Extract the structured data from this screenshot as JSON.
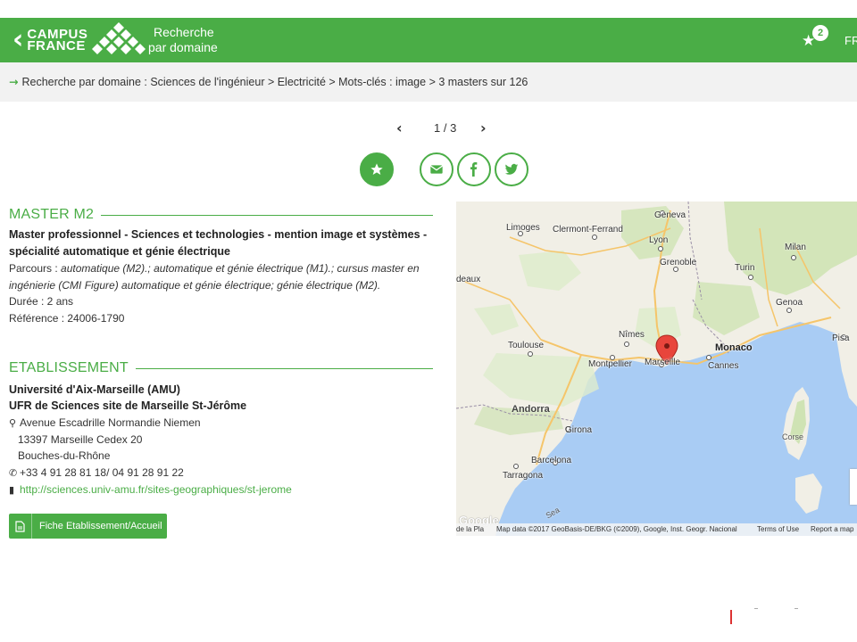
{
  "header": {
    "brand_line1": "CAMPUS",
    "brand_line2": "FRANCE",
    "section_line1": "Recherche",
    "section_line2": "par domaine",
    "favorites_count": "2",
    "language": "FR",
    "color": "#4aad46"
  },
  "breadcrumb": {
    "text": "Recherche par domaine : Sciences de l'ingénieur > Electricité > Mots-clés : image > 3 masters sur 126"
  },
  "pager": {
    "current": "1 / 3"
  },
  "actions": {
    "icons": [
      "star-icon",
      "mail-icon",
      "facebook-icon",
      "twitter-icon"
    ]
  },
  "master": {
    "heading": "MASTER M2",
    "title": "Master professionnel - Sciences et technologies - mention image et systèmes - spécialité automatique et génie électrique",
    "parcours_label": "Parcours : ",
    "parcours_value": "automatique (M2).; automatique et génie électrique (M1).; cursus master en ingénierie (CMI Figure) automatique et génie électrique; génie électrique (M2).",
    "duration": "Durée : 2 ans",
    "reference": "Référence : 24006-1790"
  },
  "etablissement": {
    "heading": "ETABLISSEMENT",
    "university": "Université d'Aix-Marseille (AMU)",
    "ufr": "UFR de Sciences site de Marseille St-Jérôme",
    "address": "Avenue Escadrille Normandie Niemen",
    "postal": "13397 Marseille Cedex 20",
    "department": "Bouches-du-Rhône",
    "phone": "+33 4 91 28 81 18/ 04 91 28 91 22",
    "website": "http://sciences.univ-amu.fr/sites-geographiques/st-jerome",
    "button_label": "Fiche Etablissement/Accueil"
  },
  "map": {
    "cities": {
      "geneva": "Geneva",
      "limoges": "Limoges",
      "clermont": "Clermont-Ferrand",
      "lyon": "Lyon",
      "grenoble": "Grenoble",
      "milan": "Milan",
      "turin": "Turin",
      "genoa": "Genoa",
      "deaux": "deaux",
      "toulouse": "Toulouse",
      "nimes": "Nîmes",
      "montpellier": "Montpellier",
      "marseille": "Marseille",
      "cannes": "Cannes",
      "monaco": "Monaco",
      "pisa": "Pisa",
      "andorra": "Andorra",
      "girona": "Girona",
      "barcelona": "Barcelona",
      "tarragona": "Tarragona",
      "corse": "Corse",
      "sea": "Sea"
    },
    "footer_left": "de la Pla",
    "map_data": "Map data ©2017 GeoBasis-DE/BKG (©2009), Google, Inst. Geogr. Nacional",
    "terms": "Terms of Use",
    "report": "Report a map",
    "google": "Google",
    "colors": {
      "sea": "#a9ccf4",
      "land": "#f1efe6",
      "green": "#cfe3b4",
      "road": "#f5c56a",
      "pin": "#e8453c"
    }
  }
}
